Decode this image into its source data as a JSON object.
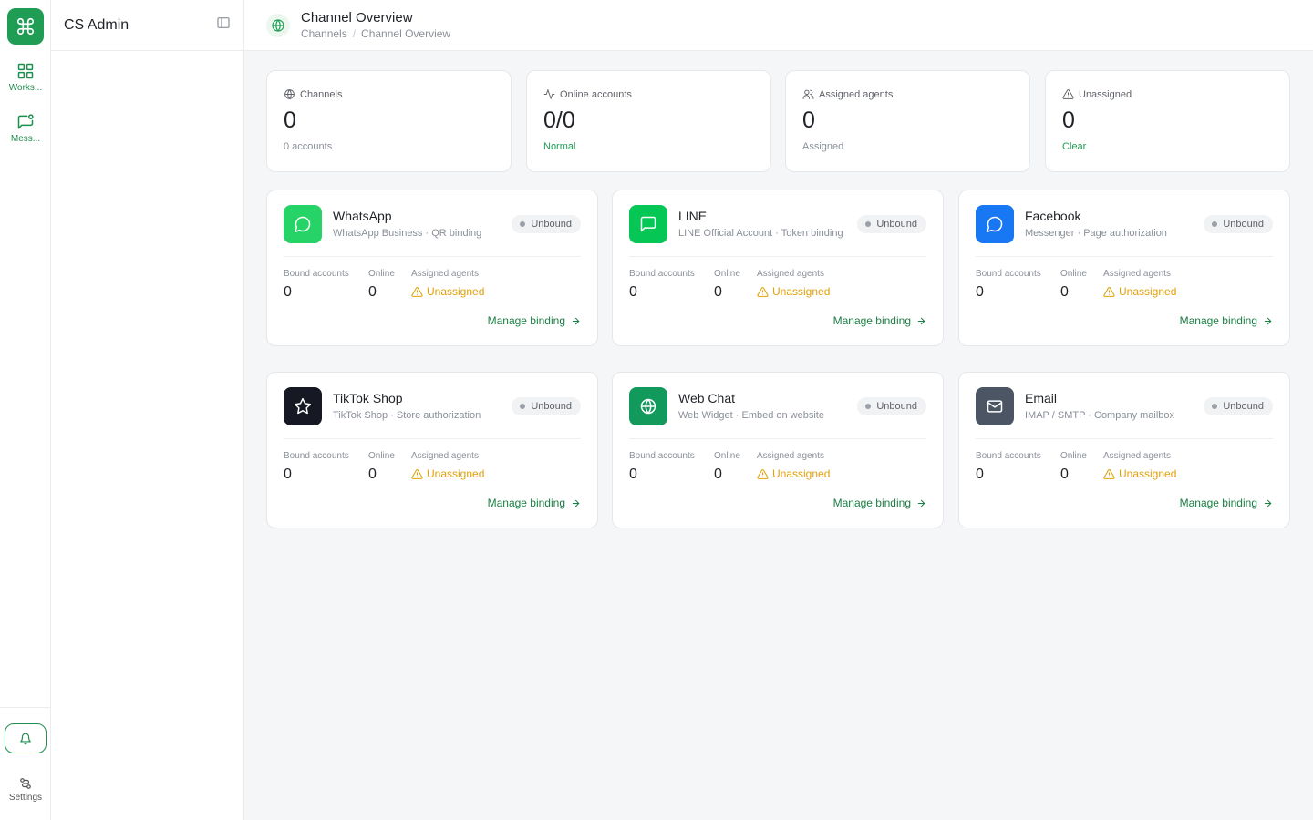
{
  "rail": {
    "items": [
      {
        "label": "Works..."
      },
      {
        "label": "Mess..."
      }
    ],
    "settings_label": "Settings"
  },
  "panel": {
    "title": "CS Admin"
  },
  "header": {
    "title": "Channel Overview",
    "breadcrumb": [
      "Channels",
      "/",
      "Channel Overview"
    ]
  },
  "stats": [
    {
      "label": "Channels",
      "value": "0",
      "sub": "0 accounts",
      "icon": "globe-icon"
    },
    {
      "label": "Online accounts",
      "value": "0/0",
      "sub": "Normal",
      "icon": "activity-icon"
    },
    {
      "label": "Assigned agents",
      "value": "0",
      "sub": "Assigned",
      "icon": "users-icon"
    },
    {
      "label": "Unassigned",
      "value": "0",
      "sub": "Clear",
      "icon": "warning-icon"
    }
  ],
  "colors": {
    "accent": "#1f9d55",
    "link": "#1a7f44",
    "warning": "#e3a008",
    "whatsapp": "#25d366",
    "line": "#06c755",
    "facebook": "#1877f2",
    "tiktok": "#161823",
    "webchat": "#129a5c",
    "email": "#4b5563"
  },
  "metric_labels": {
    "bound": "Bound accounts",
    "online": "Online",
    "agents": "Assigned agents"
  },
  "channels": [
    {
      "name": "WhatsApp",
      "desc": "WhatsApp Business · QR binding",
      "status": "Unbound",
      "bound": "0",
      "online": "0",
      "agents": "Unassigned",
      "action": "Manage binding",
      "icon": "chat-bubble-icon"
    },
    {
      "name": "LINE",
      "desc": "LINE Official Account · Token binding",
      "status": "Unbound",
      "bound": "0",
      "online": "0",
      "agents": "Unassigned",
      "action": "Manage binding",
      "icon": "message-square-icon"
    },
    {
      "name": "Facebook",
      "desc": "Messenger · Page authorization",
      "status": "Unbound",
      "bound": "0",
      "online": "0",
      "agents": "Unassigned",
      "action": "Manage binding",
      "icon": "messenger-icon"
    },
    {
      "name": "TikTok Shop",
      "desc": "TikTok Shop · Store authorization",
      "status": "Unbound",
      "bound": "0",
      "online": "0",
      "agents": "Unassigned",
      "action": "Manage binding",
      "icon": "star-icon"
    },
    {
      "name": "Web Chat",
      "desc": "Web Widget · Embed on website",
      "status": "Unbound",
      "bound": "0",
      "online": "0",
      "agents": "Unassigned",
      "action": "Manage binding",
      "icon": "globe-icon"
    },
    {
      "name": "Email",
      "desc": "IMAP / SMTP · Company mailbox",
      "status": "Unbound",
      "bound": "0",
      "online": "0",
      "agents": "Unassigned",
      "action": "Manage binding",
      "icon": "mail-icon"
    }
  ]
}
